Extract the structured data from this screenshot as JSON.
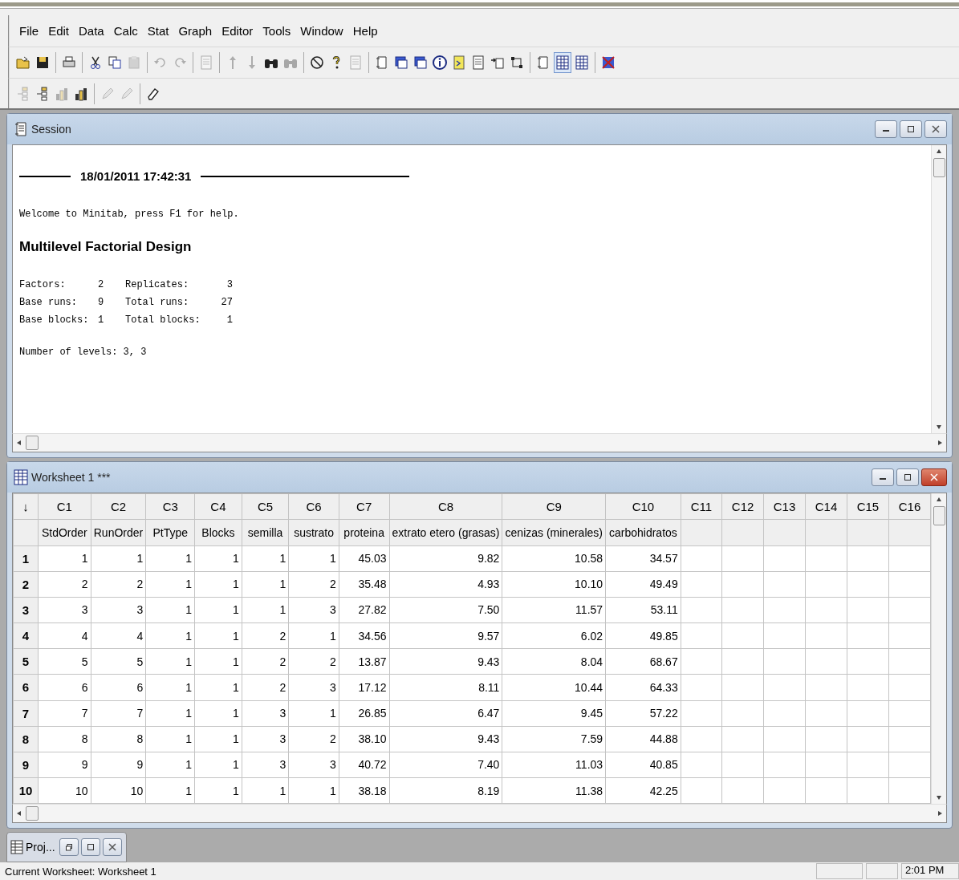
{
  "menu": [
    {
      "label": "File"
    },
    {
      "label": "Edit"
    },
    {
      "label": "Data"
    },
    {
      "label": "Calc"
    },
    {
      "label": "Stat"
    },
    {
      "label": "Graph"
    },
    {
      "label": "Editor"
    },
    {
      "label": "Tools"
    },
    {
      "label": "Window"
    },
    {
      "label": "Help"
    }
  ],
  "toolbars": [
    [
      {
        "kind": "folder",
        "disabled": false,
        "pressed": false
      },
      {
        "kind": "disk",
        "disabled": false,
        "pressed": false
      },
      {
        "kind": "separator"
      },
      {
        "kind": "printer",
        "disabled": false,
        "pressed": false
      },
      {
        "kind": "separator"
      },
      {
        "kind": "scissors",
        "disabled": false,
        "pressed": false
      },
      {
        "kind": "copy",
        "disabled": false,
        "pressed": false
      },
      {
        "kind": "paste",
        "disabled": true,
        "pressed": false
      },
      {
        "kind": "separator"
      },
      {
        "kind": "undo",
        "disabled": true,
        "pressed": false
      },
      {
        "kind": "redo",
        "disabled": true,
        "pressed": false
      },
      {
        "kind": "separator"
      },
      {
        "kind": "page",
        "disabled": true,
        "pressed": false
      },
      {
        "kind": "separator"
      },
      {
        "kind": "up",
        "disabled": true,
        "pressed": false
      },
      {
        "kind": "down",
        "disabled": true,
        "pressed": false
      },
      {
        "kind": "binoculars",
        "disabled": false,
        "pressed": false
      },
      {
        "kind": "binoculars",
        "disabled": true,
        "pressed": false
      },
      {
        "kind": "separator"
      },
      {
        "kind": "ban",
        "disabled": false,
        "pressed": false
      },
      {
        "kind": "question",
        "disabled": false,
        "pressed": false
      },
      {
        "kind": "page",
        "disabled": true,
        "pressed": false
      },
      {
        "kind": "separator"
      },
      {
        "kind": "scroll",
        "disabled": false,
        "pressed": false
      },
      {
        "kind": "window",
        "disabled": false,
        "pressed": false
      },
      {
        "kind": "window",
        "disabled": false,
        "pressed": false
      },
      {
        "kind": "info",
        "disabled": false,
        "pressed": false
      },
      {
        "kind": "note",
        "disabled": false,
        "pressed": false
      },
      {
        "kind": "page",
        "disabled": false,
        "pressed": false
      },
      {
        "kind": "arrow-page",
        "disabled": false,
        "pressed": false
      },
      {
        "kind": "nodes",
        "disabled": false,
        "pressed": false
      },
      {
        "kind": "separator"
      },
      {
        "kind": "scroll",
        "disabled": false,
        "pressed": false
      },
      {
        "kind": "grid",
        "disabled": false,
        "pressed": true
      },
      {
        "kind": "grid",
        "disabled": false,
        "pressed": false
      },
      {
        "kind": "separator"
      },
      {
        "kind": "cross-window",
        "disabled": false,
        "pressed": false
      }
    ],
    [
      {
        "kind": "tree",
        "disabled": true,
        "pressed": false
      },
      {
        "kind": "tree",
        "disabled": false,
        "pressed": false
      },
      {
        "kind": "bars",
        "disabled": true,
        "pressed": false
      },
      {
        "kind": "bars",
        "disabled": false,
        "pressed": false
      },
      {
        "kind": "separator"
      },
      {
        "kind": "pencil",
        "disabled": true,
        "pressed": false
      },
      {
        "kind": "pencil",
        "disabled": true,
        "pressed": false
      },
      {
        "kind": "separator"
      },
      {
        "kind": "eraser",
        "disabled": false,
        "pressed": false
      }
    ]
  ],
  "session": {
    "title": "Session",
    "active": false,
    "timestamp": "18/01/2011 17:42:31",
    "welcome": "Welcome to Minitab, press F1 for help.",
    "heading": "Multilevel Factorial Design",
    "summary": [
      [
        "Factors:",
        "2",
        "Replicates:",
        "3"
      ],
      [
        "Base runs:",
        "9",
        "Total runs:",
        "27"
      ],
      [
        "Base blocks:",
        "1",
        "Total blocks:",
        "1"
      ]
    ],
    "levels": "Number of levels: 3, 3"
  },
  "worksheet": {
    "title": "Worksheet 1 ***",
    "active": true,
    "corner": "↓",
    "columns": [
      {
        "id": "C1",
        "name": "StdOrder"
      },
      {
        "id": "C2",
        "name": "RunOrder"
      },
      {
        "id": "C3",
        "name": "PtType"
      },
      {
        "id": "C4",
        "name": "Blocks"
      },
      {
        "id": "C5",
        "name": "semilla"
      },
      {
        "id": "C6",
        "name": "sustrato"
      },
      {
        "id": "C7",
        "name": "proteina"
      },
      {
        "id": "C8",
        "name": "extrato etero (grasas)"
      },
      {
        "id": "C9",
        "name": "cenizas (minerales)"
      },
      {
        "id": "C10",
        "name": "carbohidratos"
      },
      {
        "id": "C11"
      },
      {
        "id": "C12"
      },
      {
        "id": "C13"
      },
      {
        "id": "C14"
      },
      {
        "id": "C15"
      },
      {
        "id": "C16"
      }
    ],
    "rows": [
      {
        "num": "1",
        "cells": [
          "1",
          "1",
          "1",
          "1",
          "1",
          "1",
          "45.03",
          "9.82",
          "10.58",
          "34.57"
        ]
      },
      {
        "num": "2",
        "cells": [
          "2",
          "2",
          "1",
          "1",
          "1",
          "2",
          "35.48",
          "4.93",
          "10.10",
          "49.49"
        ]
      },
      {
        "num": "3",
        "cells": [
          "3",
          "3",
          "1",
          "1",
          "1",
          "3",
          "27.82",
          "7.50",
          "11.57",
          "53.11"
        ]
      },
      {
        "num": "4",
        "cells": [
          "4",
          "4",
          "1",
          "1",
          "2",
          "1",
          "34.56",
          "9.57",
          "6.02",
          "49.85"
        ]
      },
      {
        "num": "5",
        "cells": [
          "5",
          "5",
          "1",
          "1",
          "2",
          "2",
          "13.87",
          "9.43",
          "8.04",
          "68.67"
        ]
      },
      {
        "num": "6",
        "cells": [
          "6",
          "6",
          "1",
          "1",
          "2",
          "3",
          "17.12",
          "8.11",
          "10.44",
          "64.33"
        ]
      },
      {
        "num": "7",
        "cells": [
          "7",
          "7",
          "1",
          "1",
          "3",
          "1",
          "26.85",
          "6.47",
          "9.45",
          "57.22"
        ]
      },
      {
        "num": "8",
        "cells": [
          "8",
          "8",
          "1",
          "1",
          "3",
          "2",
          "38.10",
          "9.43",
          "7.59",
          "44.88"
        ]
      },
      {
        "num": "9",
        "cells": [
          "9",
          "9",
          "1",
          "1",
          "3",
          "3",
          "40.72",
          "7.40",
          "11.03",
          "40.85"
        ]
      },
      {
        "num": "10",
        "cells": [
          "10",
          "10",
          "1",
          "1",
          "1",
          "1",
          "38.18",
          "8.19",
          "11.38",
          "42.25"
        ]
      }
    ]
  },
  "project": {
    "title": "Proj..."
  },
  "status_bar": {
    "text": "Current Worksheet: Worksheet 1",
    "time": "2:01 PM"
  }
}
